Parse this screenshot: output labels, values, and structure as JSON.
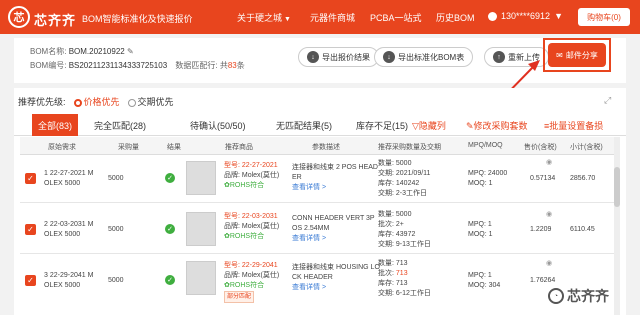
{
  "nav": {
    "logo_glyph": "芯",
    "brand": "芯齐齐",
    "tagline": "BOM智能标准化及快速报价",
    "items": [
      "关于硬之城",
      "元器件商城",
      "PCBA一站式",
      "历史BOM"
    ],
    "user": "130****6912",
    "buy": "购物车(0)"
  },
  "bom": {
    "name_label": "BOM名称:",
    "name": "BOM.20210922",
    "no_label": "BOM编号:",
    "no": "BS20211231134333725103",
    "config_label": "数据匹配行:",
    "config_pre": "共",
    "config_count": "83",
    "config_post": "条"
  },
  "buttons": {
    "export_quote": "导出报价结果",
    "export_std": "导出标准化BOM表",
    "reupload": "重新上传",
    "mail": "邮件分享"
  },
  "priority": {
    "label": "推荐优先级:",
    "opt1": "价格优先",
    "opt2": "交期优先"
  },
  "tabs": [
    "全部(83)",
    "完全匹配(28)",
    "待确认(50/50)",
    "无匹配结果(5)",
    "库存不足(15)"
  ],
  "actions": [
    "隐藏列",
    "修改采购套数",
    "批量设置备损"
  ],
  "table": {
    "headers": [
      "原始需求",
      "采购量",
      "结果",
      "推荐商品",
      "参数描述",
      "推荐采购数量及交期",
      "MPQ/MOQ",
      "售价(含税)",
      "小计(含税)"
    ],
    "rows": [
      {
        "req": [
          "1 22-27-2021 M",
          "OLEX 5000"
        ],
        "qty": "5000",
        "model": "型号: 22-27-2021",
        "brand": "品牌: Molex(莫仕)",
        "rohs": "ROHS符合",
        "desc": [
          "连接器和线束 2 POS HEAD",
          "ER"
        ],
        "detail": "查看详情 >",
        "buy": "数量: 5000",
        "date_label": "交期:",
        "date": "2021/09/11",
        "stock": "库存: 140242",
        "lead": "交期: 2-3工作日",
        "mpq": "MPQ: 24000",
        "moq": "MOQ: 1",
        "price": "0.57134",
        "sub": "2856.70"
      },
      {
        "req": [
          "2 22-03-2031 M",
          "OLEX 5000"
        ],
        "qty": "5000",
        "model": "型号: 22-03-2031",
        "brand": "品牌: Molex(莫仕)",
        "rohs": "ROHS符合",
        "desc": [
          "CONN HEADER VERT 3P",
          "OS 2.54MM"
        ],
        "detail": "查看详情 >",
        "buy": "数量: 5000",
        "date_label": "批次:",
        "date": "2+",
        "stock": "库存: 43972",
        "lead": "交期: 9-13工作日",
        "mpq": "MPQ: 1",
        "moq": "MOQ: 1",
        "price": "1.2209",
        "sub": "6110.45"
      },
      {
        "req": [
          "3 22-29-2041 M",
          "OLEX 5000"
        ],
        "qty": "5000",
        "model": "型号: 22-29-2041",
        "brand": "品牌: Molex(莫仕)",
        "rohs": "ROHS符合",
        "tag": "部分匹配",
        "desc": [
          "连接器和线束 HOUSING LO",
          "CK HEADER"
        ],
        "detail": "查看详情 >",
        "buy": "数量: 713",
        "date_label": "批次:",
        "date": "713",
        "stock": "库存: 713",
        "lead": "交期: 6-12工作日",
        "mpq": "MPQ: 1",
        "moq": "MOQ: 304",
        "price": "1.76264",
        "sub": ""
      }
    ]
  },
  "watermark": "芯齐齐"
}
